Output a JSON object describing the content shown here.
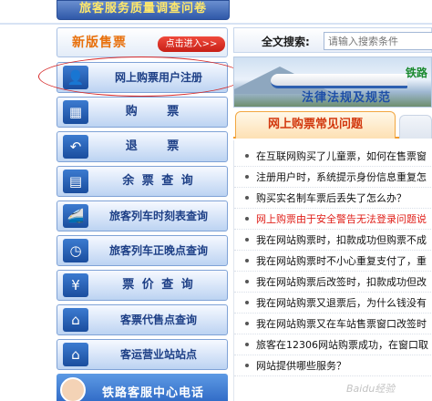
{
  "top_banner": {
    "text": "旅客服务质量调查问卷"
  },
  "sidebar": {
    "new_ticket": {
      "title": "新版售票",
      "enter_label": "点击进入>>"
    },
    "menu": [
      {
        "label": "网上购票用户注册",
        "icon": "user-register-icon",
        "glyph": "👤"
      },
      {
        "label": "购  票",
        "icon": "ticket-purchase-icon",
        "glyph": "▦"
      },
      {
        "label": "退  票",
        "icon": "refund-arrow-icon",
        "glyph": "↶"
      },
      {
        "label": "余 票 查 询",
        "icon": "ticket-grid-icon",
        "glyph": "▤"
      },
      {
        "label": "旅客列车时刻表查询",
        "icon": "train-icon",
        "glyph": "🚄"
      },
      {
        "label": "旅客列车正晚点查询",
        "icon": "clock-icon",
        "glyph": "◷"
      },
      {
        "label": "票 价 查 询",
        "icon": "yen-icon",
        "glyph": "¥"
      },
      {
        "label": "客票代售点查询",
        "icon": "shop-icon",
        "glyph": "⌂"
      },
      {
        "label": "客运营业站站点",
        "icon": "station-house-icon",
        "glyph": "⌂"
      }
    ],
    "hotline": {
      "label": "铁路客服中心电话"
    }
  },
  "search": {
    "label": "全文搜索:",
    "placeholder": "请输入搜索条件"
  },
  "banner": {
    "tag1": "铁路",
    "tag2": "法律法规及规范"
  },
  "faq": {
    "tab_label": "网上购票常见问题",
    "items": [
      {
        "text": "在互联网购买了儿童票，如何在售票窗",
        "red": false
      },
      {
        "text": "注册用户时，系统提示身份信息重复怎",
        "red": false
      },
      {
        "text": "购买实名制车票后丢失了怎么办？",
        "red": false
      },
      {
        "text": "网上购票由于安全警告无法登录问题说",
        "red": true
      },
      {
        "text": "我在网站购票时，扣款成功但购票不成",
        "red": false
      },
      {
        "text": "我在网站购票时不小心重复支付了，重",
        "red": false
      },
      {
        "text": "我在网站购票后改签时，扣款成功但改",
        "red": false
      },
      {
        "text": "我在网站购票又退票后，为什么钱没有",
        "red": false
      },
      {
        "text": "我在网站购票又在车站售票窗口改签时",
        "red": false
      },
      {
        "text": "旅客在12306网站购票成功，在窗口取",
        "red": false
      },
      {
        "text": "网站提供哪些服务？",
        "red": false
      }
    ]
  },
  "watermark": "Baidu经验"
}
